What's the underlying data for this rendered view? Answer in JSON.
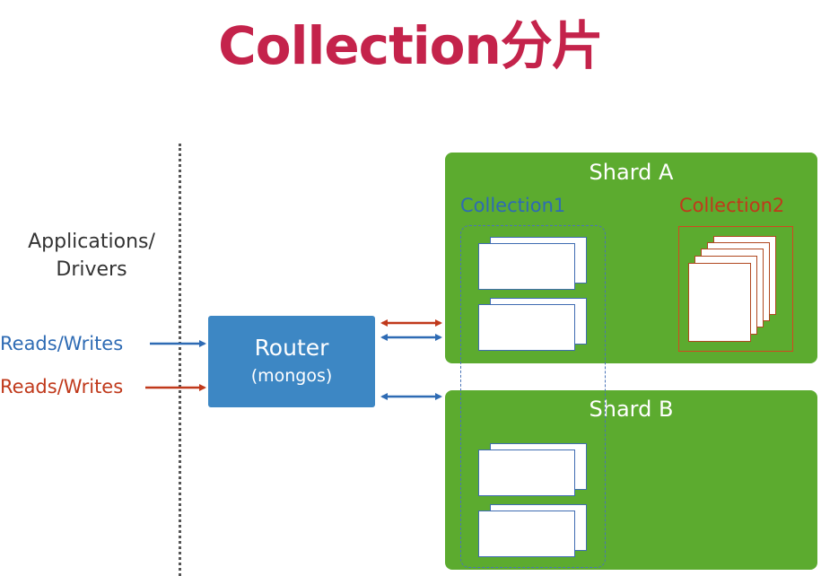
{
  "title": "Collection分片",
  "applications_label": [
    "Applications/",
    "Drivers"
  ],
  "reads_writes": [
    "Reads/Writes",
    "Reads/Writes"
  ],
  "router": {
    "title": "Router",
    "subtitle": "(mongos)"
  },
  "shards": [
    {
      "name": "Shard A"
    },
    {
      "name": "Shard B"
    }
  ],
  "collections": [
    {
      "name": "Collection1"
    },
    {
      "name": "Collection2"
    }
  ],
  "colors": {
    "title": "#c4234b",
    "blue": "#2e6bb4",
    "red": "#c0391b",
    "router": "#3d87c4",
    "shard": "#5cab2f"
  }
}
